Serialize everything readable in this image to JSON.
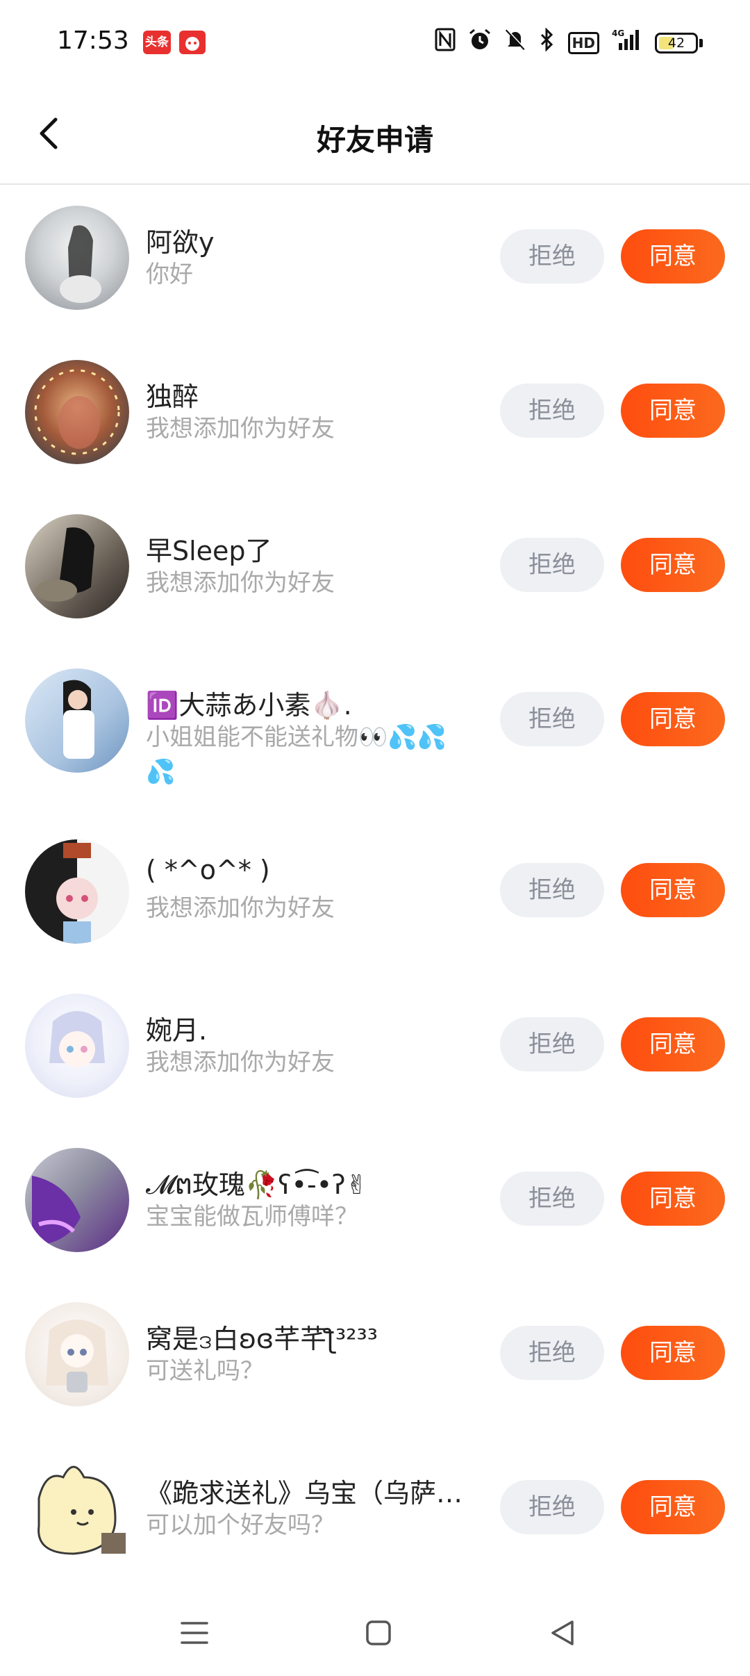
{
  "status_bar": {
    "time": "17:53",
    "badge_toutiao": "头条",
    "icons": [
      "nfc-icon",
      "alarm-icon",
      "mute-icon",
      "bluetooth-icon",
      "hd-icon",
      "signal-4g-icon"
    ],
    "hd_label": "HD",
    "battery_level": "42"
  },
  "header": {
    "title": "好友申请"
  },
  "requests": [
    {
      "name": "阿欲y",
      "message": "你好",
      "reject": "拒绝",
      "accept": "同意"
    },
    {
      "name": "独醉",
      "message": "我想添加你为好友",
      "reject": "拒绝",
      "accept": "同意"
    },
    {
      "name": "早Sleep了",
      "message": "我想添加你为好友",
      "reject": "拒绝",
      "accept": "同意"
    },
    {
      "name": "🆔大蒜あ小素🧄.",
      "message": "小姐姐能不能送礼物👀💦💦💦",
      "reject": "拒绝",
      "accept": "同意"
    },
    {
      "name": "( *^o^* )",
      "message": "我想添加你为好友",
      "reject": "拒绝",
      "accept": "同意"
    },
    {
      "name": "婉月.",
      "message": "我想添加你为好友",
      "reject": "拒绝",
      "accept": "同意"
    },
    {
      "name": "𝓜ຕ玫瑰🥀ʕ•͡-•ʔ✌",
      "message": "宝宝能做瓦师傅咩？",
      "reject": "拒绝",
      "accept": "同意"
    },
    {
      "name": "窝是ဒ白ʚɞ芊芊ƪ³²³³",
      "message": "可送礼吗？",
      "reject": "拒绝",
      "accept": "同意"
    },
    {
      "name": "《跪求送礼》乌宝（乌萨…",
      "message": "可以加个好友吗？",
      "reject": "拒绝",
      "accept": "同意"
    }
  ],
  "nav_bar": {
    "icons": [
      "menu-icon",
      "home-square-icon",
      "back-triangle-icon"
    ]
  }
}
